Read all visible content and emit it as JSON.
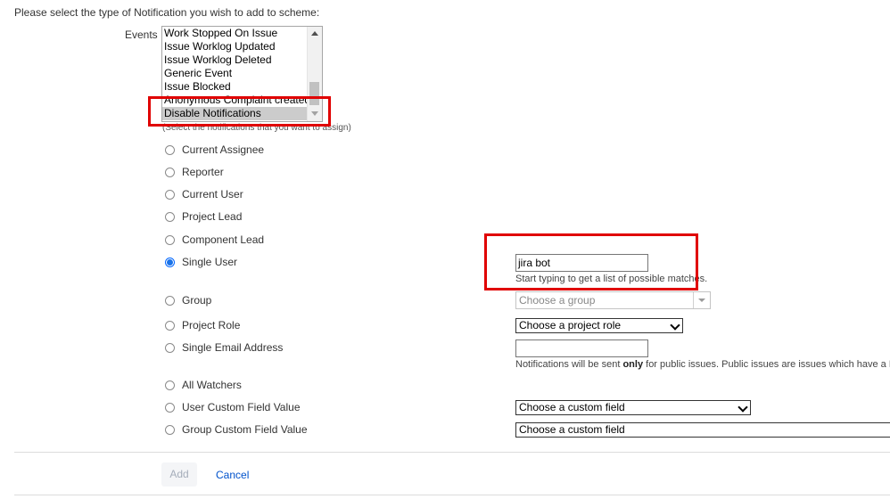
{
  "intro_text": "Please select the type of Notification you wish to add to scheme:",
  "events": {
    "label": "Events",
    "options": [
      "Work Stopped On Issue",
      "Issue Worklog Updated",
      "Issue Worklog Deleted",
      "Generic Event",
      "Issue Blocked",
      "Anonymous Complaint created",
      "Disable Notifications"
    ],
    "selected": "Disable Notifications",
    "hint": "(Select the notifications that you want to assign)"
  },
  "recipients": [
    {
      "label": "Current Assignee",
      "checked": false
    },
    {
      "label": "Reporter",
      "checked": false
    },
    {
      "label": "Current User",
      "checked": false
    },
    {
      "label": "Project Lead",
      "checked": false
    },
    {
      "label": "Component Lead",
      "checked": false
    },
    {
      "label": "Single User",
      "checked": true
    },
    {
      "label": "Group",
      "checked": false
    },
    {
      "label": "Project Role",
      "checked": false
    },
    {
      "label": "Single Email Address",
      "checked": false
    },
    {
      "label": "All Watchers",
      "checked": false
    },
    {
      "label": "User Custom Field Value",
      "checked": false
    },
    {
      "label": "Group Custom Field Value",
      "checked": false
    }
  ],
  "single_user": {
    "value": "jira bot",
    "help": "Start typing to get a list of possible matches."
  },
  "group": {
    "placeholder": "Choose a group"
  },
  "project_role": {
    "selected": "Choose a project role"
  },
  "email": {
    "value": "",
    "help_prefix": "Notifications will be sent ",
    "help_bold": "only",
    "help_suffix": " for public issues. Public issues are issues which have a Permis"
  },
  "user_custom_field": {
    "selected": "Choose a custom field"
  },
  "group_custom_field": {
    "selected": "Choose a custom field"
  },
  "actions": {
    "add": "Add",
    "cancel": "Cancel"
  },
  "colors": {
    "highlight": "#e00000",
    "link": "#0052cc",
    "radio_checked": "#1a73e8"
  }
}
